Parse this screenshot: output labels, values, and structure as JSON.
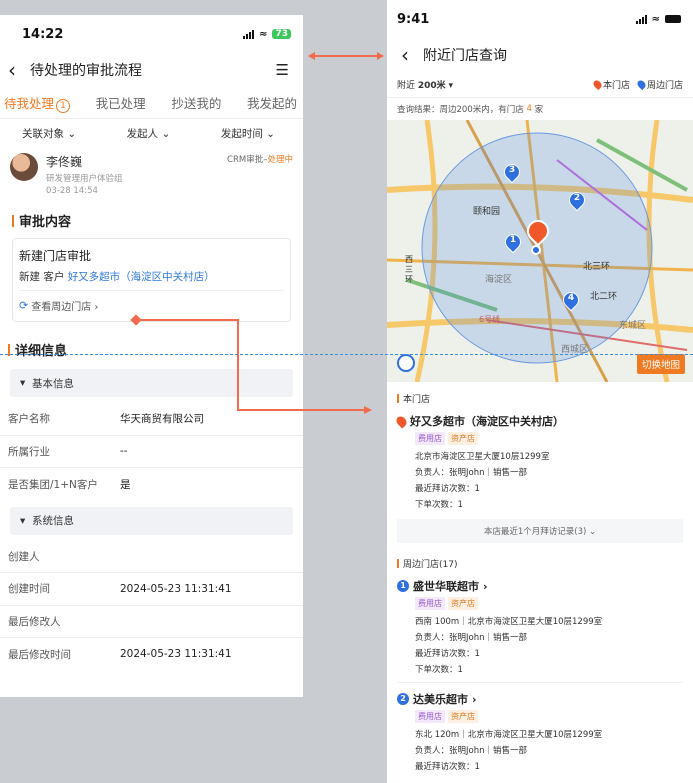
{
  "left": {
    "status_time": "14:22",
    "battery": "73",
    "nav_title": "待处理的审批流程",
    "tabs": [
      {
        "label": "待我处理",
        "badge": "1"
      },
      {
        "label": "我已处理"
      },
      {
        "label": "抄送我的"
      },
      {
        "label": "我发起的"
      }
    ],
    "filters": [
      "关联对象",
      "发起人",
      "发起时间"
    ],
    "applicant": {
      "name": "李佟巍",
      "dept": "研发管理用户体验组",
      "date": "03-28 14:54",
      "status_prefix": "CRM审批–",
      "status": "处理中"
    },
    "approval_section": "审批内容",
    "approval_card": {
      "title": "新建门店审批",
      "line_prefix": "新建 客户",
      "store_link": "好又多超市（海淀区中关村店）",
      "nearby_link": "查看周边门店 ›"
    },
    "detail_section": "详细信息",
    "basic_group": "基本信息",
    "basic_rows": [
      {
        "k": "客户名称",
        "v": "华天商贸有限公司"
      },
      {
        "k": "所属行业",
        "v": "--"
      },
      {
        "k": "是否集团/1+N客户",
        "v": "是"
      }
    ],
    "system_group": "系统信息",
    "system_rows": [
      {
        "k": "创建人",
        "v": ""
      },
      {
        "k": "创建时间",
        "v": "2024-05-23 11:31:41"
      },
      {
        "k": "最后修改人",
        "v": ""
      },
      {
        "k": "最后修改时间",
        "v": "2024-05-23 11:31:41"
      }
    ]
  },
  "right": {
    "status_time": "9:41",
    "nav_title": "附近门店查询",
    "range_prefix": "附近",
    "range_value": "200米",
    "legend_self": "本门店",
    "legend_nearby": "周边门店",
    "result_prefix": "查询结果：周边200米内，有门店",
    "result_count": "4",
    "result_suffix": "家",
    "map_labels": [
      "颐和园",
      "海淀区",
      "西三环",
      "北三环",
      "北二环",
      "东城区",
      "西城区",
      "6号线"
    ],
    "switch_map": "切换地图",
    "markers": [
      "1",
      "2",
      "3",
      "4"
    ],
    "self_section": "本门店",
    "self_store": {
      "name": "好又多超市（海淀区中关村店）",
      "tags": [
        "费用店",
        "资产店"
      ],
      "address": "北京市海淀区卫星大厦10层1299室",
      "owner": "负责人：张明John｜销售一部",
      "visits": "最近拜访次数：1",
      "orders": "下单次数：1"
    },
    "visits_record": "本店最近1个月拜访记录(3) ⌄",
    "nearby_section": "周边门店(17)",
    "nearby": [
      {
        "num": "1",
        "name": "盛世华联超市",
        "tags": [
          "费用店",
          "资产店"
        ],
        "address": "西南 100m｜北京市海淀区卫星大厦10层1299室",
        "owner": "负责人：张明John｜销售一部",
        "visits": "最近拜访次数：1",
        "orders": "下单次数：1"
      },
      {
        "num": "2",
        "name": "达美乐超市",
        "tags": [
          "费用店",
          "资产店"
        ],
        "address": "东北 120m｜北京市海淀区卫星大厦10层1299室",
        "owner": "负责人：张明John｜销售一部",
        "visits": "最近拜访次数：1"
      }
    ]
  },
  "colors": {
    "accent": "#f07a22",
    "link": "#2f78d8",
    "pin_blue": "#2f6fe0",
    "pin_red": "#f0582a",
    "connector": "#f26b4f"
  }
}
